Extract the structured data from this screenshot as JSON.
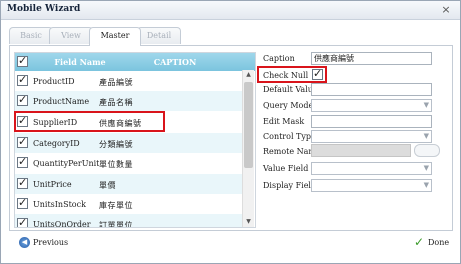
{
  "window": {
    "title": "Mobile Wizard",
    "close_label": "×"
  },
  "tabs": [
    {
      "label": "Basic",
      "active": false
    },
    {
      "label": "View",
      "active": false
    },
    {
      "label": "Master",
      "active": true
    },
    {
      "label": "Detail",
      "active": false
    }
  ],
  "grid": {
    "header": {
      "field": "Field Name",
      "caption": "CAPTION",
      "checked": true
    },
    "rows": [
      {
        "field": "ProductID",
        "caption": "產品編號",
        "checked": true
      },
      {
        "field": "ProductName",
        "caption": "產品名稱",
        "checked": true
      },
      {
        "field": "SupplierID",
        "caption": "供應商編號",
        "checked": true
      },
      {
        "field": "CategoryID",
        "caption": "分類編號",
        "checked": true
      },
      {
        "field": "QuantityPerUnit",
        "caption": "單位數量",
        "checked": true
      },
      {
        "field": "UnitPrice",
        "caption": "單價",
        "checked": true
      },
      {
        "field": "UnitsInStock",
        "caption": "庫存單位",
        "checked": true
      },
      {
        "field": "UnitsOnOrder",
        "caption": "訂單單位",
        "checked": true
      }
    ]
  },
  "properties": {
    "caption_label": "Caption",
    "caption_value": "供應商編號",
    "check_null_label": "Check Null",
    "check_null": true,
    "default_value_label": "Default Value",
    "default_value": "",
    "query_mode_label": "Query Mode",
    "edit_mask_label": "Edit Mask",
    "edit_mask": "",
    "control_type_label": "Control Type",
    "remote_name_label": "Remote Name",
    "value_field_label": "Value Field",
    "display_field_label": "Display Field"
  },
  "footer": {
    "previous": "Previous",
    "done": "Done"
  },
  "colors": {
    "header": "#7bc4de",
    "highlight": "#d9141b",
    "alt_row": "#e9f6fa"
  }
}
